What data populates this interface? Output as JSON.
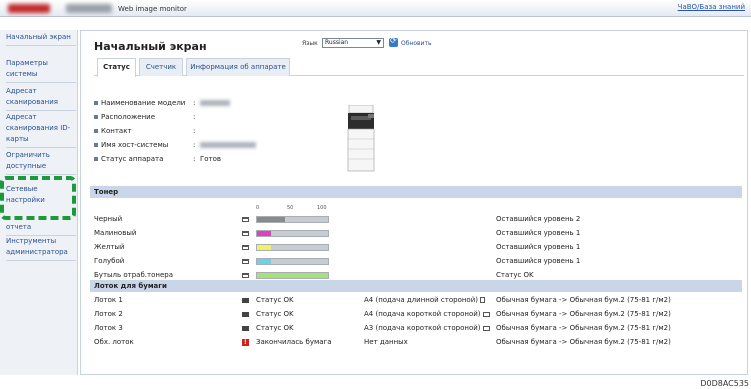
{
  "app": {
    "title": "Web image monitor",
    "help_link": "ЧаВО/База знаний"
  },
  "sidebar": {
    "items": [
      {
        "label": "Начальный экран"
      },
      {
        "label": "Параметры системы"
      },
      {
        "label": "Адресат сканирования"
      },
      {
        "label": "Адресат сканирования ID-карты"
      },
      {
        "label": "Ограничить доступные"
      },
      {
        "label": "Сетевые настройки"
      },
      {
        "label": "отчета"
      },
      {
        "label": "Инструменты администратора"
      }
    ]
  },
  "header": {
    "page_title": "Начальный экран",
    "language_label": "Язык",
    "language_value": "Russian",
    "refresh_label": "Обновить"
  },
  "tabs": [
    {
      "label": "Статус"
    },
    {
      "label": "Счетчик"
    },
    {
      "label": "Информация об аппарате"
    }
  ],
  "device_info": [
    {
      "label": "Наименование модели"
    },
    {
      "label": "Расположение"
    },
    {
      "label": "Контакт"
    },
    {
      "label": "Имя хост-системы"
    },
    {
      "label": "Статус аппарата",
      "value": "Готов"
    }
  ],
  "toner": {
    "section_title": "Тонер",
    "scale": [
      "0",
      "50",
      "100"
    ],
    "rows": [
      {
        "name": "Черный",
        "status": "Оставшийся уровень 2",
        "level": 0.4,
        "color": "#8a8a8a"
      },
      {
        "name": "Малиновый",
        "status": "Оставшийся уровень 1",
        "level": 0.2,
        "color": "#e040c0"
      },
      {
        "name": "Желтый",
        "status": "Оставшийся уровень 1",
        "level": 0.2,
        "color": "#f4f060"
      },
      {
        "name": "Голубой",
        "status": "Оставшийся уровень 1",
        "level": 0.2,
        "color": "#70d0e8"
      },
      {
        "name": "Бутыль отраб.тонера",
        "status": "Статус OK",
        "level": 1.0,
        "color": "#a8e07a"
      }
    ]
  },
  "paper": {
    "section_title": "Лоток для бумаги",
    "rows": [
      {
        "name": "Лоток 1",
        "status": "Статус OK",
        "size": "A4 (подача длинной стороной)",
        "type": "Обычная бумага -> Обычная бум.2 (75-81 г/м2)",
        "error": false
      },
      {
        "name": "Лоток 2",
        "status": "Статус OK",
        "size": "A4 (подача короткой стороной)",
        "type": "Обычная бумага -> Обычная бум.2 (75-81 г/м2)",
        "error": false
      },
      {
        "name": "Лоток 3",
        "status": "Статус OK",
        "size": "A3 (подача короткой стороной)",
        "type": "Обычная бумага -> Обычная бум.2 (75-81 г/м2)",
        "error": false
      },
      {
        "name": "Обх. лоток",
        "status": "Закончилась бумага",
        "size": "Нет данных",
        "type": "Обычная бумага -> Обычная бум.2 (75-81 г/м2)",
        "error": true
      }
    ]
  },
  "footer_code": "D0D8AC535"
}
